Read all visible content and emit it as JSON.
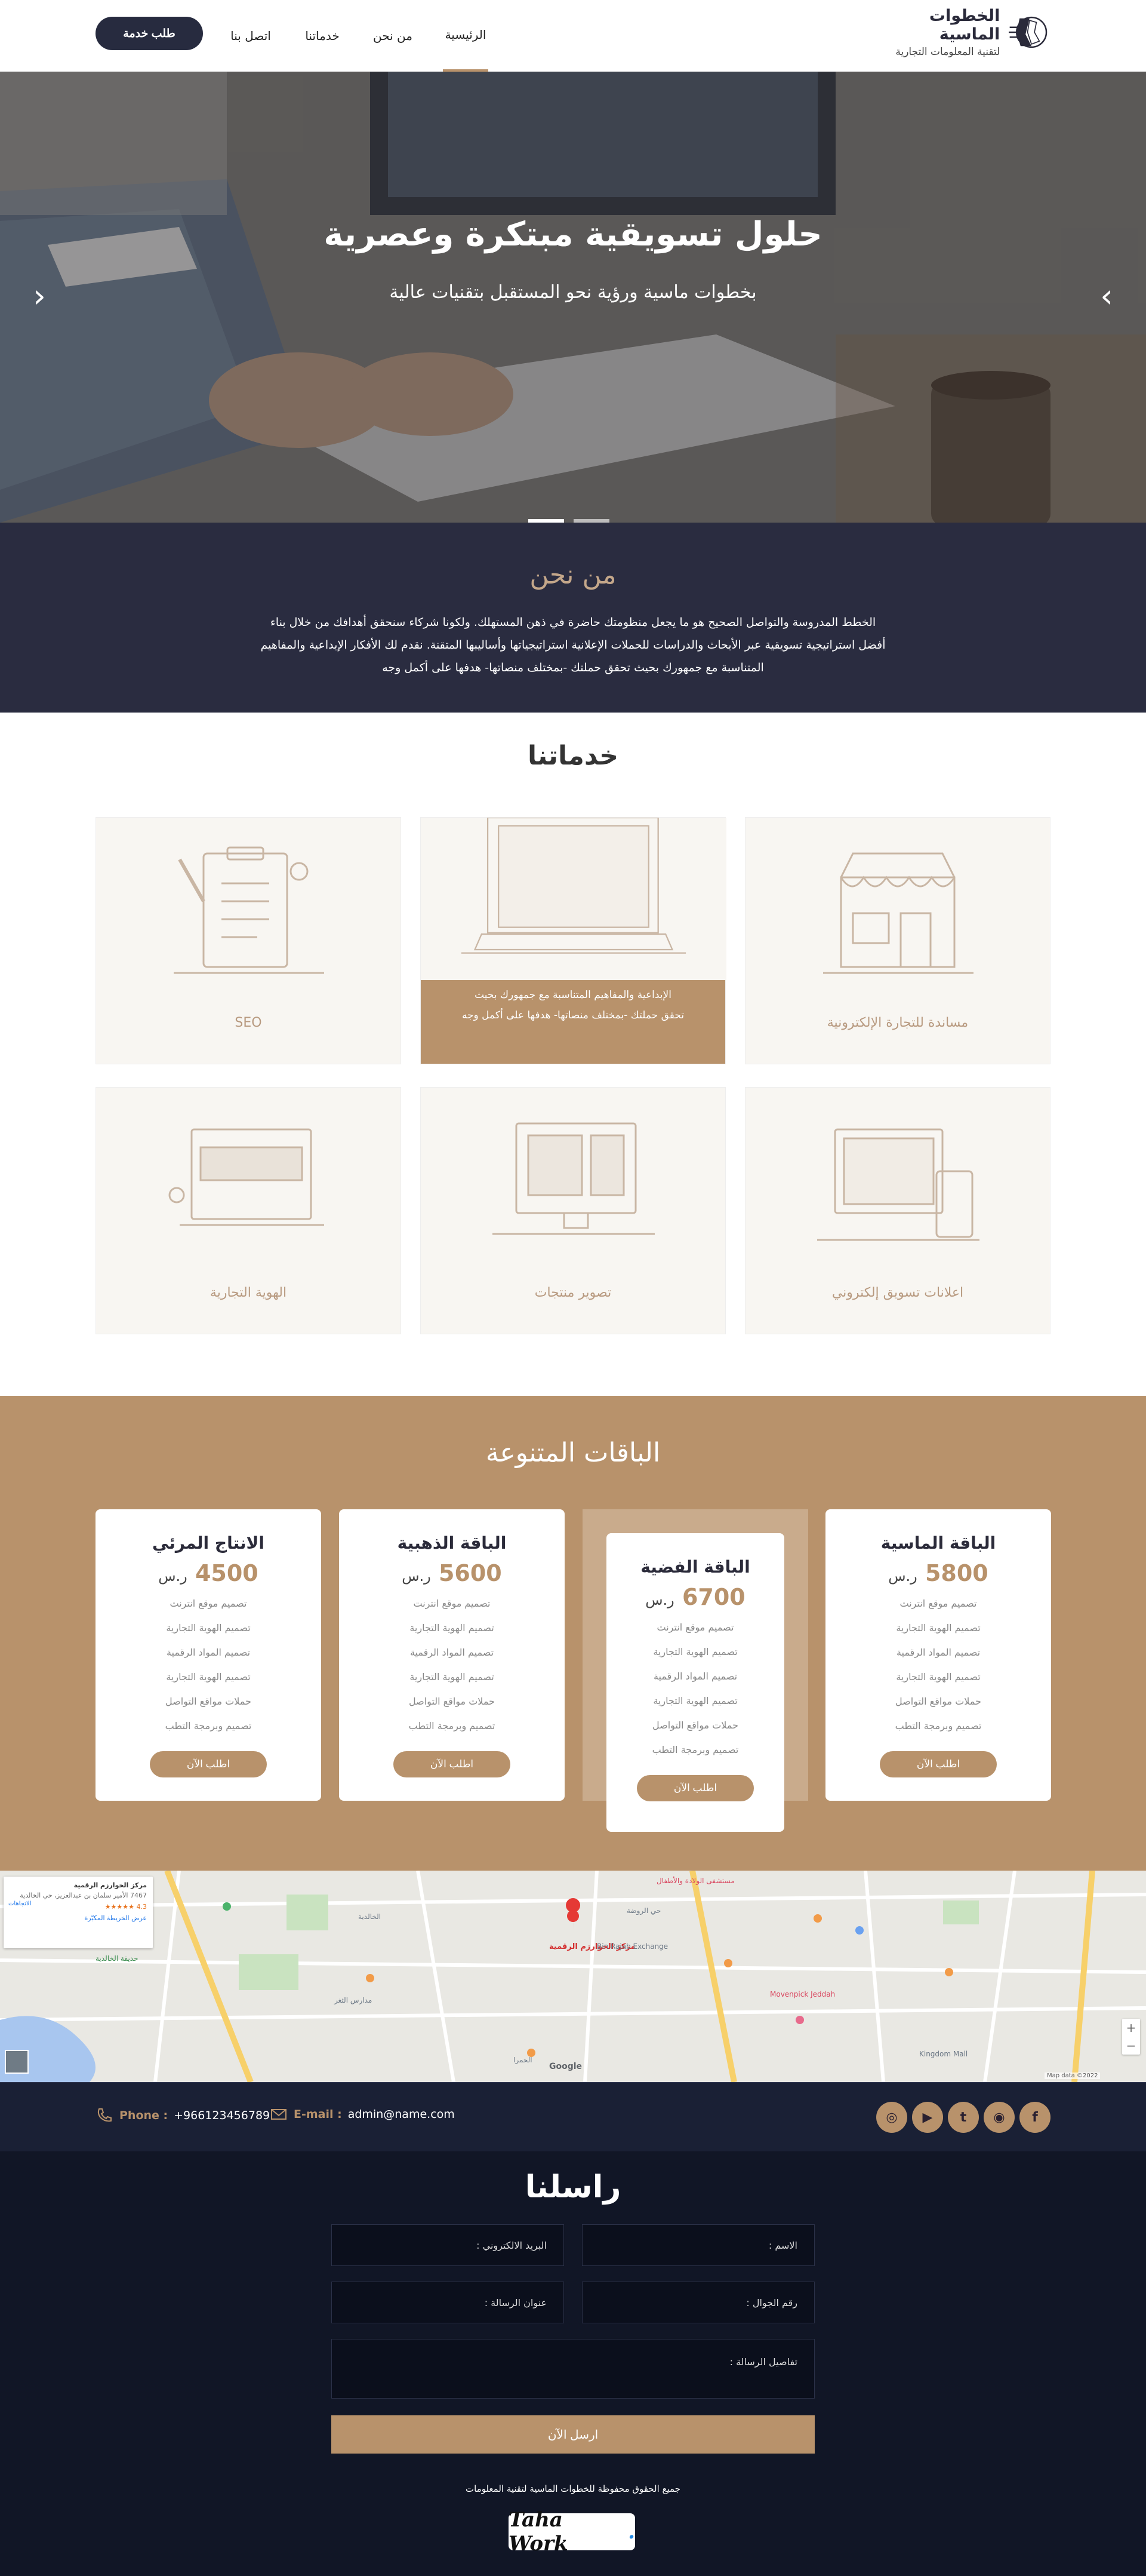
{
  "header": {
    "logo_title": "الخطوات الماسية",
    "logo_subtitle": "لتقنية المعلومات التجارية",
    "nav": [
      "الرئيسية",
      "من نحن",
      "خدماتنا",
      "اتصل بنا"
    ],
    "request_button": "طلب خدمة"
  },
  "hero": {
    "title": "حلول تسويقية مبتكرة وعصرية",
    "subtitle": "بخطوات ماسية ورؤية نحو المستقبل بتقنيات عالية",
    "prev_icon": "chevron-left-icon",
    "next_icon": "chevron-right-icon",
    "slides": 2,
    "active_slide": 2
  },
  "about": {
    "title": "من نحن",
    "text": "الخطط المدروسة والتواصل الصحيح هو ما يجعل منظومتك حاضرة في ذهن المستهلك. ولكونا شركاء سنحقق أهدافك من خلال بناء أفضل استراتيجية تسويقية عبر الأبحاث والدراسات للحملات الإعلانية استراتيجياتها وأساليبها المتقنة. نقدم لك الأفكار الإبداعية والمفاهيم المتناسبة مع جمهورك بحيث تحقق حملتك -بمختلف منصاتها- هدفها على أكمل وجه"
  },
  "services": {
    "title": "خدماتنا",
    "items": [
      {
        "label": "مساندة للتجارة الإلكترونية",
        "icon": "storefront-illustration"
      },
      {
        "label": "",
        "icon": "laptop-illustration",
        "hover_text_1": "الإبداعية والمفاهيم المتناسبة مع جمهورك بحيث",
        "hover_text_2": "تحقق حملتك -بمختلف منصاتها- هدفها على أكمل وجه"
      },
      {
        "label": "SEO",
        "icon": "checklist-illustration"
      },
      {
        "label": "اعلانات تسويق إلكتروني",
        "icon": "devices-illustration"
      },
      {
        "label": "تصوير منتجات",
        "icon": "monitor-illustration"
      },
      {
        "label": "الهوية التجارية",
        "icon": "branding-illustration"
      }
    ]
  },
  "packages": {
    "title": "الباقات المتنوعة",
    "currency": "ر.س",
    "button": "اطلب الآن",
    "items": [
      {
        "name": "الباقة الماسية",
        "price": "5800",
        "features": [
          "تصميم موقع انترنت",
          "تصميم الهوية التجارية",
          "تصميم المواد الرقمية",
          "تصميم الهوية التجارية",
          "حملات مواقع التواصل",
          "تصميم وبرمجة التطب"
        ]
      },
      {
        "name": "الباقة الفضية",
        "price": "6700",
        "features": [
          "تصميم موقع انترنت",
          "تصميم الهوية التجارية",
          "تصميم المواد الرقمية",
          "تصميم الهوية التجارية",
          "حملات مواقع التواصل",
          "تصميم وبرمجة التطب"
        ]
      },
      {
        "name": "الباقة الذهبية",
        "price": "5600",
        "features": [
          "تصميم موقع انترنت",
          "تصميم الهوية التجارية",
          "تصميم المواد الرقمية",
          "تصميم الهوية التجارية",
          "حملات مواقع التواصل",
          "تصميم وبرمجة التطب"
        ]
      },
      {
        "name": "الانتاج المرئي",
        "price": "4500",
        "features": [
          "تصميم موقع انترنت",
          "تصميم الهوية التجارية",
          "تصميم المواد الرقمية",
          "تصميم الهوية التجارية",
          "حملات مواقع التواصل",
          "تصميم وبرمجة التطب"
        ]
      }
    ]
  },
  "map": {
    "place_name": "مركز الخوارزم الرقمية",
    "popup_title": "مركز الخوارزم الرقمية",
    "popup_address": "7467 الأمير سلمان بن عبدالعزيز، حي الخالدية",
    "popup_rating": "4.3",
    "popup_reviews": "عرض الخريطة المكبّرة",
    "directions_label": "الاتجاهات",
    "zoom_in": "+",
    "zoom_out": "−",
    "attribution": "Map data ©2022",
    "google": "Google",
    "labels": [
      "الخالدية",
      "حي الروضة",
      "Bin Rajab Exchange",
      "Movenpick Jeddah",
      "مدارس الثغر",
      "حديقة الخالدية",
      "Kingdom Mall",
      "مستشفى الولادة والأطفال",
      "الحمرا"
    ]
  },
  "contact": {
    "phone_label": "Phone :",
    "phone": "+966123456789",
    "email_label": "E-mail :",
    "email": "admin@name.com",
    "social_icons": [
      "facebook-icon",
      "snapchat-icon",
      "twitter-icon",
      "youtube-icon",
      "instagram-icon"
    ],
    "social_glyphs": [
      "f",
      "◉",
      "t",
      "▶",
      "◎"
    ]
  },
  "form": {
    "title": "راسلنا",
    "name": "الاسم :",
    "email": "البريد الالكتروني :",
    "mobile": "رقم الجوال :",
    "subject": "عنوان الرسالة :",
    "details": "تفاصيل الرسالة :",
    "send": "ارسل الآن",
    "copyright": "جميع الحقوق محفوظة للخطوات الماسية لتقنية المعلومات",
    "badge_text": "Taha Work",
    "badge_dot": "."
  },
  "colors": {
    "accent": "#b8926b",
    "dark": "#2a2c40",
    "footer": "#111626"
  }
}
